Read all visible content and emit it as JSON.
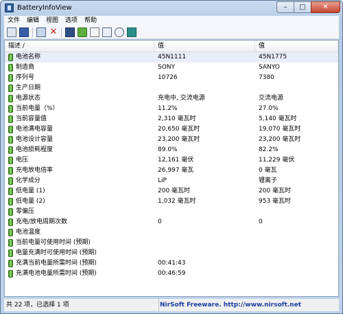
{
  "window": {
    "title": "BatteryInfoView",
    "min": "–",
    "max": "□",
    "close": "✕"
  },
  "menu": [
    "文件",
    "编辑",
    "视图",
    "选项",
    "帮助"
  ],
  "toolbar": [
    "properties-icon",
    "report-icon",
    "html-icon",
    "delete-icon",
    "save-icon",
    "refresh-icon",
    "copy-icon",
    "html-report-icon",
    "find-icon",
    "exit-icon"
  ],
  "columns": [
    "描述   /",
    "值",
    "值"
  ],
  "rows": [
    [
      "电池名称",
      "45N1111",
      "45N1775"
    ],
    [
      "制造商",
      "SONY",
      "SANYO"
    ],
    [
      "序列号",
      "10726",
      " 7380"
    ],
    [
      "生产日期",
      "",
      ""
    ],
    [
      "电源状态",
      "充电中, 交流电源",
      "交流电源"
    ],
    [
      "当前电量（%）",
      "11.2%",
      "27.0%"
    ],
    [
      "当前容量值",
      "2,310 毫瓦时",
      "5,140 毫瓦时"
    ],
    [
      "电池满电容量",
      "20,650 毫瓦时",
      "19,070 毫瓦时"
    ],
    [
      "电池设计容量",
      "23,200 毫瓦时",
      "23,200 毫瓦时"
    ],
    [
      "电池损耗程度",
      "89.0%",
      "82.2%"
    ],
    [
      "电压",
      "12,161 毫伏",
      "11,229 毫伏"
    ],
    [
      "充电放电倍率",
      "26,997 毫瓦",
      "0 毫瓦"
    ],
    [
      "化学成分",
      "LiP",
      "锂离子"
    ],
    [
      "低电量 (1)",
      "200 毫瓦时",
      "200 毫瓦时"
    ],
    [
      "低电量 (2)",
      "1,032 毫瓦时",
      "953 毫瓦时"
    ],
    [
      "零偏压",
      "",
      ""
    ],
    [
      "充电/放电周期次数",
      "0",
      "0"
    ],
    [
      "电池温度",
      "",
      ""
    ],
    [
      "当前电量可使用时间 (预期)",
      "",
      ""
    ],
    [
      "电量充满时可使用时间 (预期)",
      "",
      ""
    ],
    [
      "充满当前电量所需时间 (预期)",
      "00:41:43",
      ""
    ],
    [
      "充满电池电量所需时间 (预期)",
      "00:46:59",
      ""
    ]
  ],
  "status": {
    "left": "共 22 项，已选择 1 项",
    "right": "NirSoft Freeware.  http://www.nirsoft.net"
  }
}
